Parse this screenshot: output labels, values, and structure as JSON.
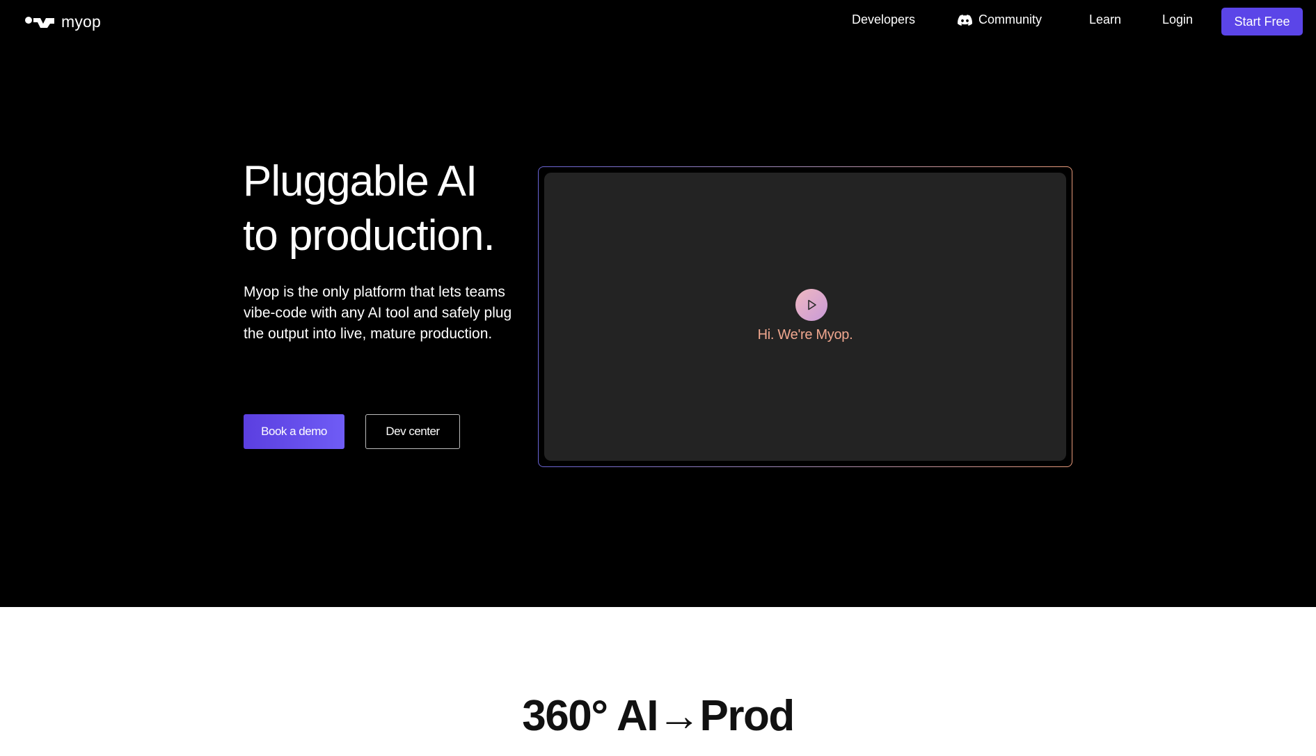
{
  "nav": {
    "logo_text": "myop",
    "links": [
      {
        "label": "Developers"
      },
      {
        "label": "Community",
        "icon": "discord-icon"
      },
      {
        "label": "Learn"
      },
      {
        "label": "Login"
      }
    ],
    "cta_label": "Start Free"
  },
  "hero": {
    "headline_line1": "Pluggable AI",
    "headline_line2": "to production.",
    "subtext": "Myop is the only platform that lets teams vibe-code with any AI tool and safely plug the output into live, mature production.",
    "primary_button": "Book a demo",
    "secondary_button": "Dev center"
  },
  "video": {
    "caption": "Hi. We're Myop.",
    "play_icon": "play-icon"
  },
  "section2": {
    "title": "360° AI→Prod"
  },
  "colors": {
    "hero_bg": "#000000",
    "accent": "#5b45e8",
    "video_panel": "#232323",
    "caption": "#f0a78f",
    "page_bg": "#ffffff"
  }
}
